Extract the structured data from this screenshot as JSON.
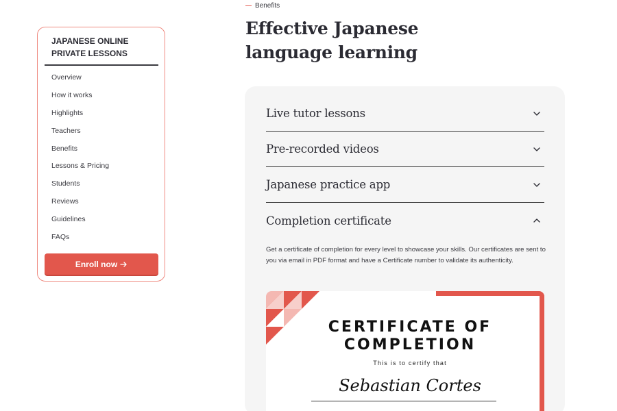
{
  "sidebar": {
    "title_line1": "JAPANESE ONLINE",
    "title_line2": "PRIVATE LESSONS",
    "items": [
      {
        "label": "Overview"
      },
      {
        "label": "How it works"
      },
      {
        "label": "Highlights"
      },
      {
        "label": "Teachers"
      },
      {
        "label": "Benefits"
      },
      {
        "label": "Lessons & Pricing"
      },
      {
        "label": "Students"
      },
      {
        "label": "Reviews"
      },
      {
        "label": "Guidelines"
      },
      {
        "label": "FAQs"
      }
    ],
    "enroll_label": "Enroll now",
    "enroll_icon": "arrow-right-icon"
  },
  "section": {
    "eyebrow": "Benefits",
    "heading_line1": "Effective Japanese",
    "heading_line2": "language learning"
  },
  "accordion": {
    "items": [
      {
        "title": "Live tutor lessons",
        "state": "collapsed",
        "icon": "chevron-down-icon"
      },
      {
        "title": "Pre-recorded videos",
        "state": "collapsed",
        "icon": "chevron-down-icon"
      },
      {
        "title": "Japanese practice app",
        "state": "collapsed",
        "icon": "chevron-down-icon"
      },
      {
        "title": "Completion certificate",
        "state": "expanded",
        "icon": "chevron-up-icon"
      }
    ],
    "open_body": "Get a certificate of completion for every level to showcase your skills. Our certificates are sent to you via email in PDF format and have a Certificate number to validate its authenticity."
  },
  "certificate": {
    "title_line1": "CERTIFICATE OF",
    "title_line2": "COMPLETION",
    "subtitle": "This is to certify that",
    "name": "Sebastian Cortes"
  },
  "colors": {
    "accent": "#e2574c",
    "card_border": "#ef8a80",
    "panel_bg": "#f5f5f5",
    "text": "#2b2b33"
  }
}
